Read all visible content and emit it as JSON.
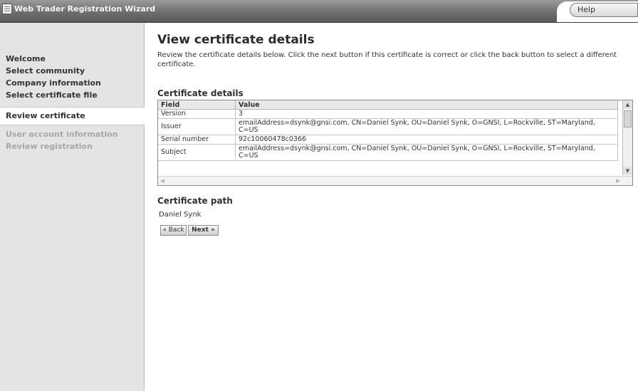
{
  "window": {
    "title": "Web Trader Registration Wizard",
    "help_label": "Help"
  },
  "sidebar": {
    "items": [
      {
        "label": "Welcome",
        "state": "completed"
      },
      {
        "label": "Select community",
        "state": "completed"
      },
      {
        "label": "Company information",
        "state": "completed"
      },
      {
        "label": "Select certificate file",
        "state": "completed"
      },
      {
        "label": "Review certificate",
        "state": "active"
      },
      {
        "label": "User account information",
        "state": "disabled"
      },
      {
        "label": "Review registration",
        "state": "disabled"
      }
    ]
  },
  "main": {
    "title": "View certificate details",
    "intro": "Review the certificate details below. Click the next button if this certificate is correct or click the back button to select a different certificate.",
    "details_heading": "Certificate details",
    "table": {
      "columns": [
        "Field",
        "Value"
      ],
      "rows": [
        {
          "field": "Version",
          "value": "3"
        },
        {
          "field": "Issuer",
          "value": "emailAddress=dsynk@gnsi.com, CN=Daniel Synk, OU=Daniel Synk, O=GNSI, L=Rockville, ST=Maryland, C=US"
        },
        {
          "field": "Serial number",
          "value": "92c10060478c0366"
        },
        {
          "field": "Subject",
          "value": "emailAddress=dsynk@gnsi.com, CN=Daniel Synk, OU=Daniel Synk, O=GNSI, L=Rockville, ST=Maryland, C=US"
        }
      ]
    },
    "path_heading": "Certificate path",
    "path_value": "Daniel Synk",
    "back_label": "« Back",
    "next_label": "Next »"
  }
}
